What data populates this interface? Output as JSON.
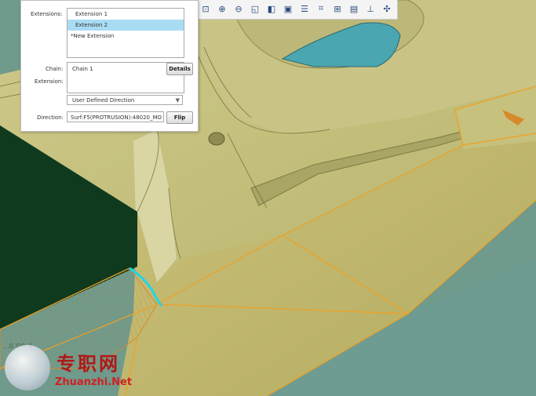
{
  "toolbar": {
    "buttons": [
      "zoom-window",
      "zoom-in",
      "zoom-out",
      "refit",
      "shading",
      "saved-views",
      "layers",
      "datum-display",
      "axis-display",
      "point-display",
      "csys-display",
      "spin-center"
    ]
  },
  "panel": {
    "extensions_label": "Extensions:",
    "extensions": [
      "Extension 1",
      "Extension 2",
      "*New Extension"
    ],
    "selected_extension_index": 1,
    "chain_label": "Chain:",
    "extension_label": "Extension:",
    "chain_value": "Chain 1",
    "details_button": "Details",
    "direction_type": "User Defined Direction",
    "direction_label": "Direction:",
    "direction_value": "Surf:F5(PROTRUSION):48020_MO",
    "flip_button": "Flip"
  },
  "viewport": {
    "part_label": "...0_DR_1"
  },
  "watermark": {
    "cn": "专职网",
    "en": "Zhuanzhi.Net"
  },
  "colors": {
    "model_surface": "#c8c27a",
    "edge_highlight": "#f0a020",
    "selection": "#1fd6e8",
    "dark_face": "#0f3a1e",
    "background": "#6f9a8c",
    "selected_item": "#a8dcf3"
  }
}
